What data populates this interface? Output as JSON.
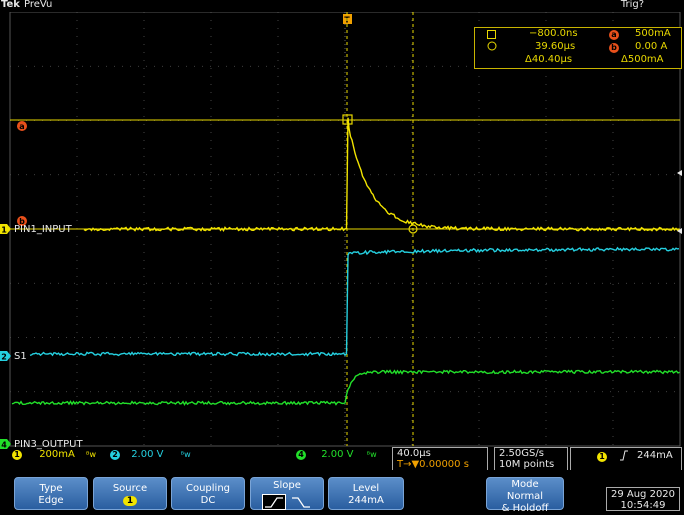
{
  "top": {
    "brand": "Tek",
    "acq_mode": "PreVu",
    "trigger_state": "Trig?"
  },
  "trigger_marker": "T",
  "channel_labels": {
    "ch1": "PIN1_INPUT",
    "ch2": "S1",
    "ch4": "PIN3_OUTPUT",
    "ch1_num": "1",
    "ch2_num": "2",
    "ch4_num": "4",
    "cursor_a": "a",
    "cursor_b": "b"
  },
  "readout": {
    "t1": "−800.0ns",
    "t2": "39.60µs",
    "dt": "Δ40.40µs",
    "a_label": "a",
    "a_value": "500mA",
    "b_label": "b",
    "b_value": "0.00 A",
    "dv": "Δ500mA"
  },
  "status": {
    "ch1_num": "1",
    "ch1_scale": "200mA",
    "ch1_bw": "ᴮw",
    "ch2_num": "2",
    "ch2_scale": "2.00 V",
    "ch2_bw": "ᴮw",
    "ch4_num": "4",
    "ch4_scale": "2.00 V",
    "ch4_bw": "ᴮw",
    "timebase": "40.0µs",
    "trig_pos": "T→▼0.00000 s",
    "sample_rate": "2.50GS/s",
    "record_len": "10M points",
    "trig_src": "1",
    "trig_level": "244mA"
  },
  "menu": {
    "type_label": "Type",
    "type_value": "Edge",
    "source_label": "Source",
    "source_value": "1",
    "coupling_label": "Coupling",
    "coupling_value": "DC",
    "slope_label": "Slope",
    "level_label": "Level",
    "level_value": "244mA",
    "mode_label": "Mode",
    "mode_value1": "Normal",
    "mode_value2": "& Holdoff"
  },
  "clock": {
    "date": "29 Aug 2020",
    "time": "10:54:49"
  },
  "colors": {
    "ch1": "#f2e400",
    "ch2": "#25d0e0",
    "ch4": "#22e02a",
    "cursor": "#e8d800",
    "grid": "#555555",
    "badge": "#e8501b"
  }
}
